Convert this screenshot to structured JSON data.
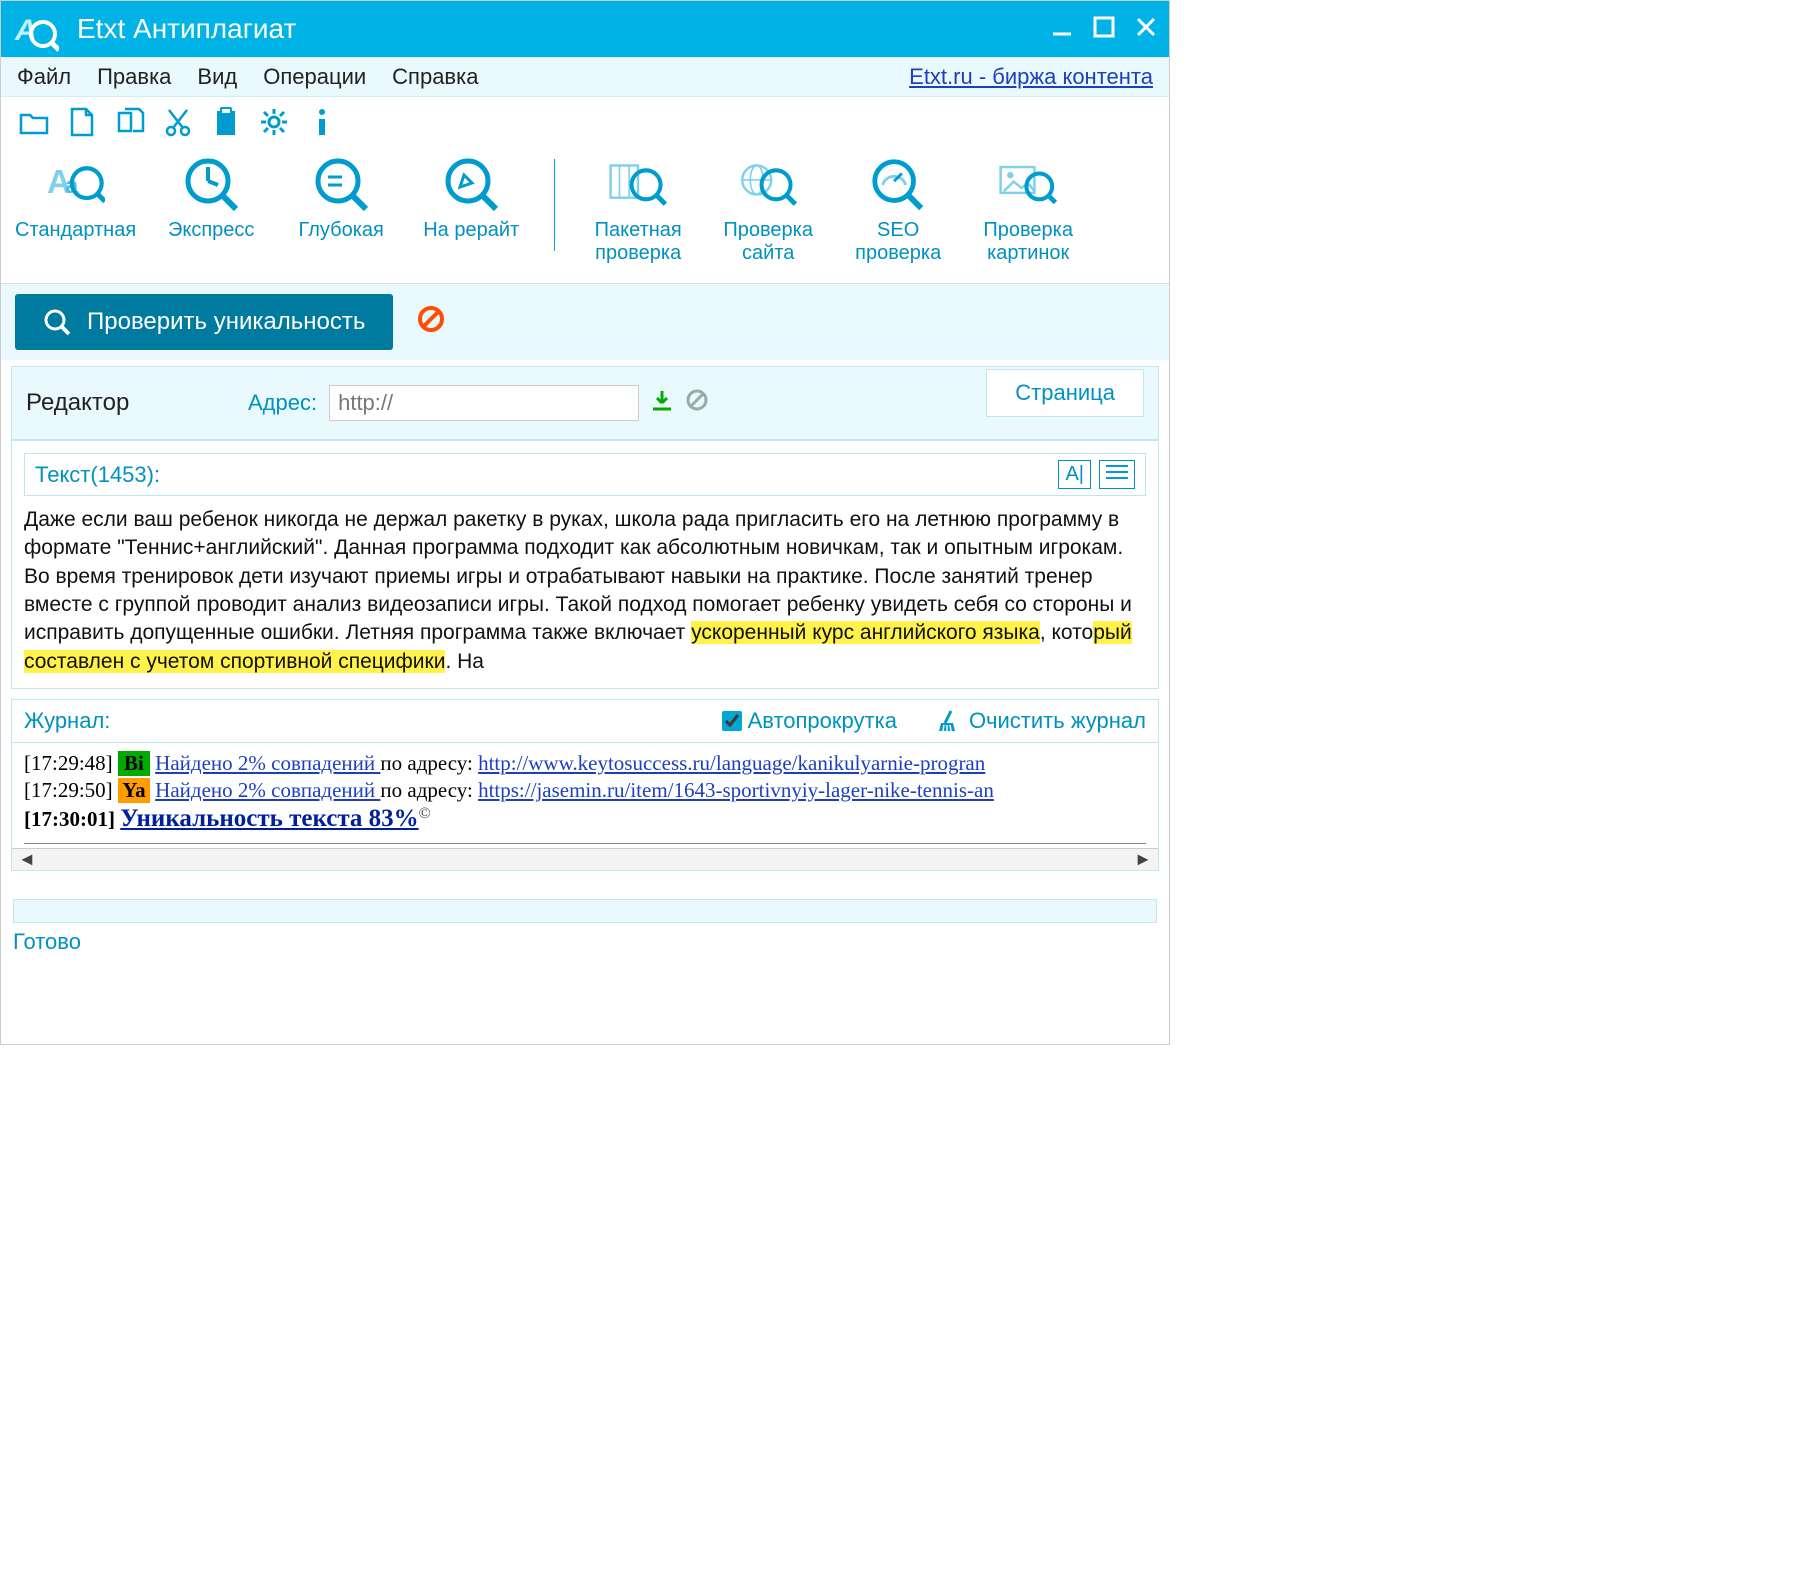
{
  "titlebar": {
    "title": "Etxt Антиплагиат"
  },
  "menubar": {
    "file": "Файл",
    "edit": "Правка",
    "view": "Вид",
    "ops": "Операции",
    "help": "Справка",
    "link": "Etxt.ru - биржа контента"
  },
  "big_toolbar": {
    "standard": "Стандартная",
    "express": "Экспресс",
    "deep": "Глубокая",
    "rewrite": "На рерайт",
    "batch1": "Пакетная",
    "batch2": "проверка",
    "site1": "Проверка",
    "site2": "сайта",
    "seo1": "SEO",
    "seo2": "проверка",
    "img1": "Проверка",
    "img2": "картинок"
  },
  "check": {
    "button": "Проверить уникальность"
  },
  "editor_row": {
    "editor": "Редактор",
    "address": "Адрес:",
    "placeholder": "http://",
    "value": "http://",
    "tab_page": "Страница"
  },
  "text_panel": {
    "label": "Текст(1453):",
    "p1a": "Даже если ваш ребенок никогда не держал ракетку в руках, школа рада пригласить его на летнюю программу в формате \"Теннис+английский\". Данная программа подходит как абсолютным новичкам, так и опытным игрокам. Во время тренировок дети изучают приемы игры и отрабатывают навыки на практике. После занятий тренер вместе с группой проводит анализ видеозаписи игры. Такой подход помогает ребенку увидеть себя со стороны и исправить допущенные ошибки. Летняя программа также включает ",
    "hl1": "ускоренный курс английского языка",
    "p1b": ", кото",
    "hl2": "рый составлен с учетом спортивной специфики",
    "p1c": ". На"
  },
  "log": {
    "label": "Журнал:",
    "autoscroll": "Автопрокрутка",
    "clear": "Очистить журнал",
    "line1_ts": "[17:29:48]",
    "line1_badge": "Bi",
    "line1_found": "Найдено 2% совпадений ",
    "line1_mid": "по адресу: ",
    "line1_url": "http://www.keytosuccess.ru/language/kanikulyarnie-progran",
    "line2_ts": "[17:29:50]",
    "line2_badge": "Ya",
    "line2_found": "Найдено 2% совпадений ",
    "line2_mid": "по адресу: ",
    "line2_url": "https://jasemin.ru/item/1643-sportivnyiy-lager-nike-tennis-an",
    "line3_ts": "[17:30:01]",
    "line3_result": "Уникальность текста 83%",
    "line3_sup": "©"
  },
  "status": "Готово"
}
